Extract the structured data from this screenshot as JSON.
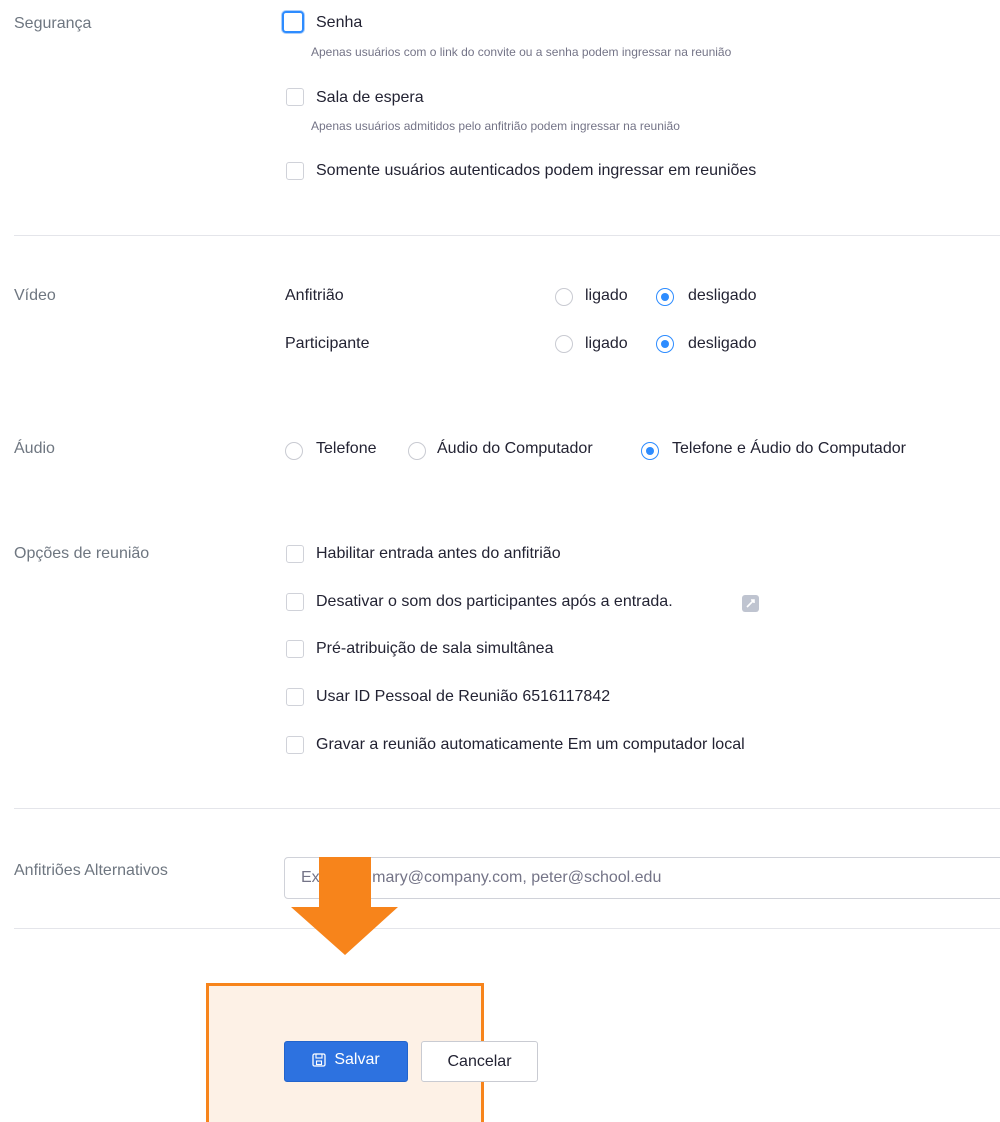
{
  "security": {
    "label": "Segurança",
    "password": {
      "label": "Senha",
      "description": "Apenas usuários com o link do convite ou a senha podem ingressar na reunião",
      "checked": false
    },
    "waiting_room": {
      "label": "Sala de espera",
      "description": "Apenas usuários admitidos pelo anfitrião podem ingressar na reunião",
      "checked": false
    },
    "auth_only": {
      "label": "Somente usuários autenticados podem ingressar em reuniões",
      "checked": false
    }
  },
  "video": {
    "label": "Vídeo",
    "host": {
      "label": "Anfitrião",
      "on": "ligado",
      "off": "desligado",
      "selected": "desligado"
    },
    "participant": {
      "label": "Participante",
      "on": "ligado",
      "off": "desligado",
      "selected": "desligado"
    }
  },
  "audio": {
    "label": "Áudio",
    "options": [
      "Telefone",
      "Áudio do Computador",
      "Telefone e Áudio do Computador"
    ],
    "selected": "Telefone e Áudio do Computador"
  },
  "meeting_options": {
    "label": "Opções de reunião",
    "items": [
      {
        "label": "Habilitar entrada antes do anfitrião",
        "checked": false
      },
      {
        "label": "Desativar o som dos participantes após a entrada.",
        "checked": false
      },
      {
        "label": "Pré-atribuição de sala simultânea",
        "checked": false
      },
      {
        "label": "Usar ID Pessoal de Reunião 6516117842",
        "checked": false
      },
      {
        "label": "Gravar a reunião automaticamente Em um computador local",
        "checked": false
      }
    ]
  },
  "alternative_hosts": {
    "label": "Anfitriões Alternativos",
    "placeholder": "Exemplo: mary@company.com, peter@school.edu",
    "value": ""
  },
  "actions": {
    "save_label": "Salvar",
    "cancel_label": "Cancelar"
  },
  "colors": {
    "accent": "#2d8cff",
    "save_button": "#2d72e0",
    "annotation": "#f7841b",
    "annotation_fill": "#fdf1e6"
  },
  "icons": {
    "save": "floppy-disk-icon",
    "info": "info-icon",
    "annotation_arrow": "arrow-down-icon"
  }
}
